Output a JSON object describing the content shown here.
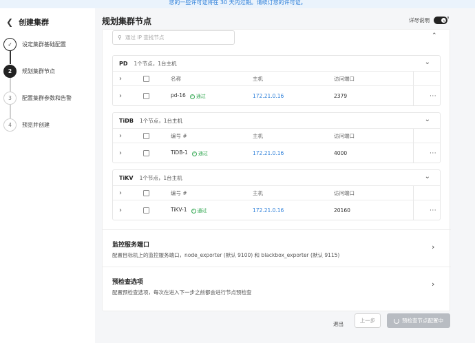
{
  "banner": {
    "text": "您的一些许可证将在 30 天内过期。",
    "link": "请续订您的许可证。"
  },
  "sidebar": {
    "back_icon": "back-arrow-icon",
    "title": "创建集群",
    "steps": [
      {
        "num": "✓",
        "label": "设定集群基础配置",
        "state": "done"
      },
      {
        "num": "2",
        "label": "规划集群节点",
        "state": "active"
      },
      {
        "num": "3",
        "label": "配置集群参数和告警",
        "state": "pending"
      },
      {
        "num": "4",
        "label": "预览并创建",
        "state": "pending"
      }
    ]
  },
  "header": {
    "title": "规划集群节点",
    "detail_label": "详尽说明",
    "detail_toggle_on": true,
    "expand_icon": "expand-icon"
  },
  "search": {
    "placeholder": "通过 IP 查找节点"
  },
  "groups": [
    {
      "name": "PD",
      "summary": "1个节点，1台主机",
      "columns": {
        "name": "名称",
        "host": "主机",
        "port": "访问端口"
      },
      "rows": [
        {
          "name": "pd-16",
          "status": "通过",
          "host": "172.21.0.16",
          "port": "2379"
        }
      ]
    },
    {
      "name": "TiDB",
      "summary": "1个节点，1台主机",
      "columns": {
        "name": "编号 #",
        "host": "主机",
        "port": "访问端口"
      },
      "rows": [
        {
          "name": "TiDB-1",
          "status": "通过",
          "host": "172.21.0.16",
          "port": "4000"
        }
      ]
    },
    {
      "name": "TiKV",
      "summary": "1个节点，1台主机",
      "columns": {
        "name": "编号 #",
        "host": "主机",
        "port": "访问端口"
      },
      "rows": [
        {
          "name": "TiKV-1",
          "status": "通过",
          "host": "172.21.0.16",
          "port": "20160"
        }
      ]
    }
  ],
  "sections": [
    {
      "title": "监控服务端口",
      "desc": "配置目标机上的监控服务端口，node_exporter (默认 9100) 和 blackbox_exporter (默认 9115)"
    },
    {
      "title": "预检查选项",
      "desc": "配置预检查选项，每次在进入下一步之前都会进行节点预检查"
    }
  ],
  "footer": {
    "exit_label": "退出",
    "prev_label": "上一步",
    "next_label": "预检查节点配置中"
  },
  "colors": {
    "accent": "#2d7fd9",
    "success": "#34a853",
    "disabled_button": "#b8bcc2",
    "step_active": "#222222"
  }
}
